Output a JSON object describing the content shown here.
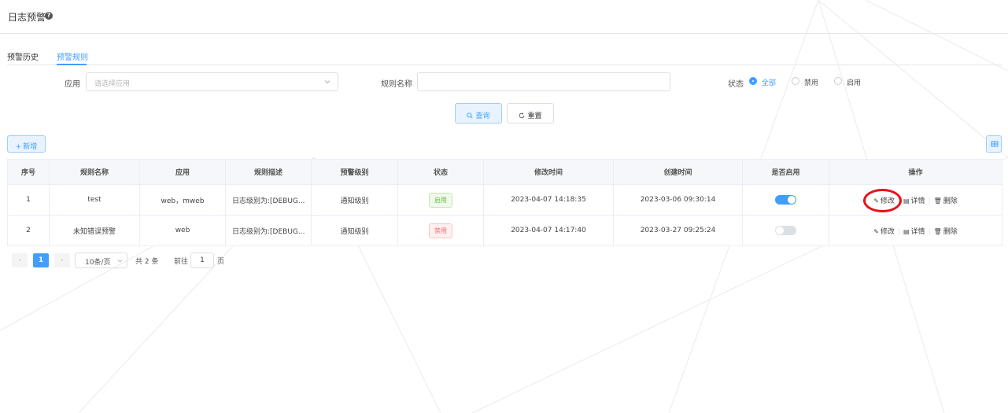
{
  "header": {
    "title": "日志预警",
    "help_icon": "question-circle-icon"
  },
  "tabs": [
    {
      "label": "预警历史",
      "active": false
    },
    {
      "label": "预警规则",
      "active": true
    }
  ],
  "filters": {
    "app_label": "应用",
    "app_placeholder": "请选择应用",
    "name_label": "规则名称",
    "name_value": "",
    "status_label": "状态",
    "status_options": [
      {
        "label": "全部",
        "checked": true
      },
      {
        "label": "禁用",
        "checked": false
      },
      {
        "label": "启用",
        "checked": false
      }
    ]
  },
  "buttons": {
    "query": "查询",
    "query_icon": "search-icon",
    "reset": "重置",
    "reset_icon": "refresh-icon",
    "add": "新增",
    "add_icon": "plus-icon",
    "columns_icon": "grid-icon"
  },
  "table": {
    "columns": [
      "序号",
      "规则名称",
      "应用",
      "规则描述",
      "预警级别",
      "状态",
      "修改时间",
      "创建时间",
      "是否启用",
      "操作"
    ],
    "rows": [
      {
        "index": "1",
        "name": "test",
        "app": "web，mweb",
        "desc": "日志级别为:[DEBUG...",
        "level": "通知级别",
        "status": "启用",
        "status_type": "enabled",
        "modified": "2023-04-07 14:18:35",
        "created": "2023-03-06 09:30:14",
        "switch_on": true
      },
      {
        "index": "2",
        "name": "未知错误预警",
        "app": "web",
        "desc": "日志级别为:[DEBUG...",
        "level": "通知级别",
        "status": "禁用",
        "status_type": "disabled",
        "modified": "2023-04-07 14:17:40",
        "created": "2023-03-27 09:25:24",
        "switch_on": false
      }
    ],
    "actions": {
      "edit": "修改",
      "detail": "详情",
      "delete": "删除"
    }
  },
  "pagination": {
    "current_page": "1",
    "page_size": "10条/页",
    "total": "共 2 条",
    "goto_label": "前往",
    "goto_value": "1",
    "page_unit": "页"
  },
  "colors": {
    "accent": "#409eff",
    "highlight": "#e8101a",
    "enabled": "#67c23a",
    "disabled": "#f56c6c"
  }
}
